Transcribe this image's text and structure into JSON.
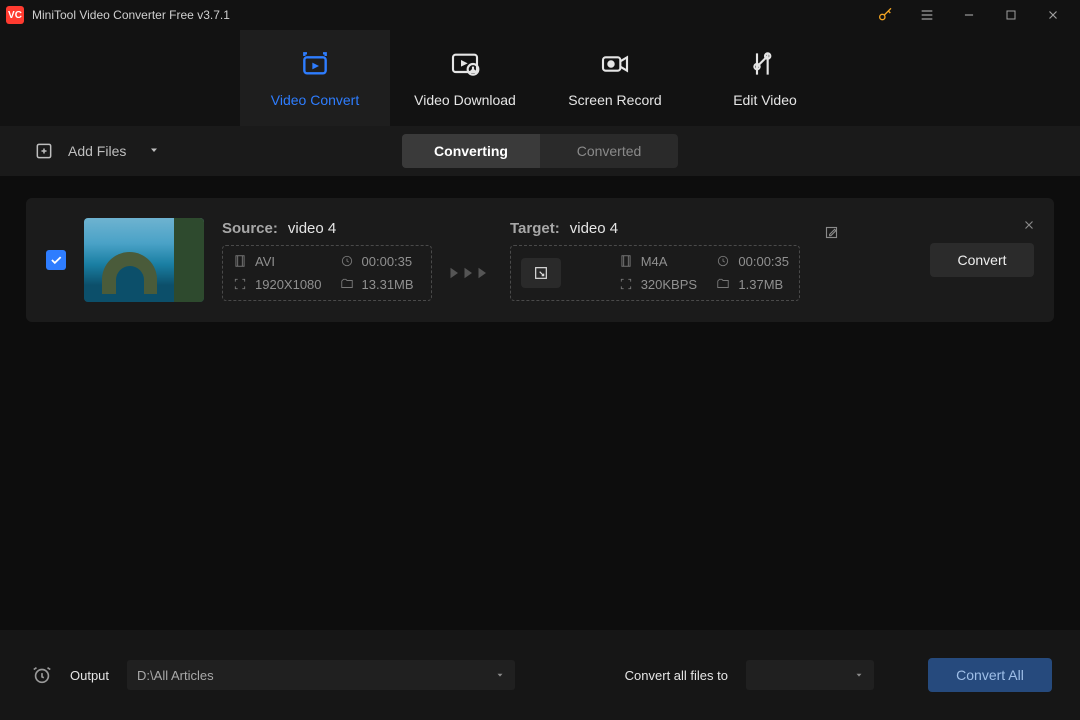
{
  "app": {
    "title": "MiniTool Video Converter Free v3.7.1"
  },
  "nav": {
    "tabs": [
      {
        "label": "Video Convert"
      },
      {
        "label": "Video Download"
      },
      {
        "label": "Screen Record"
      },
      {
        "label": "Edit Video"
      }
    ]
  },
  "toolbar": {
    "add_files": "Add Files",
    "seg_converting": "Converting",
    "seg_converted": "Converted"
  },
  "item": {
    "source": {
      "label": "Source:",
      "name": "video 4",
      "format": "AVI",
      "duration": "00:00:35",
      "resolution": "1920X1080",
      "filesize": "13.31MB"
    },
    "target": {
      "label": "Target:",
      "name": "video 4",
      "format": "M4A",
      "duration": "00:00:35",
      "bitrate": "320KBPS",
      "filesize": "1.37MB"
    },
    "convert_label": "Convert"
  },
  "footer": {
    "output_label": "Output",
    "output_path": "D:\\All Articles",
    "convert_all_to_label": "Convert all files to",
    "convert_all_button": "Convert All"
  }
}
